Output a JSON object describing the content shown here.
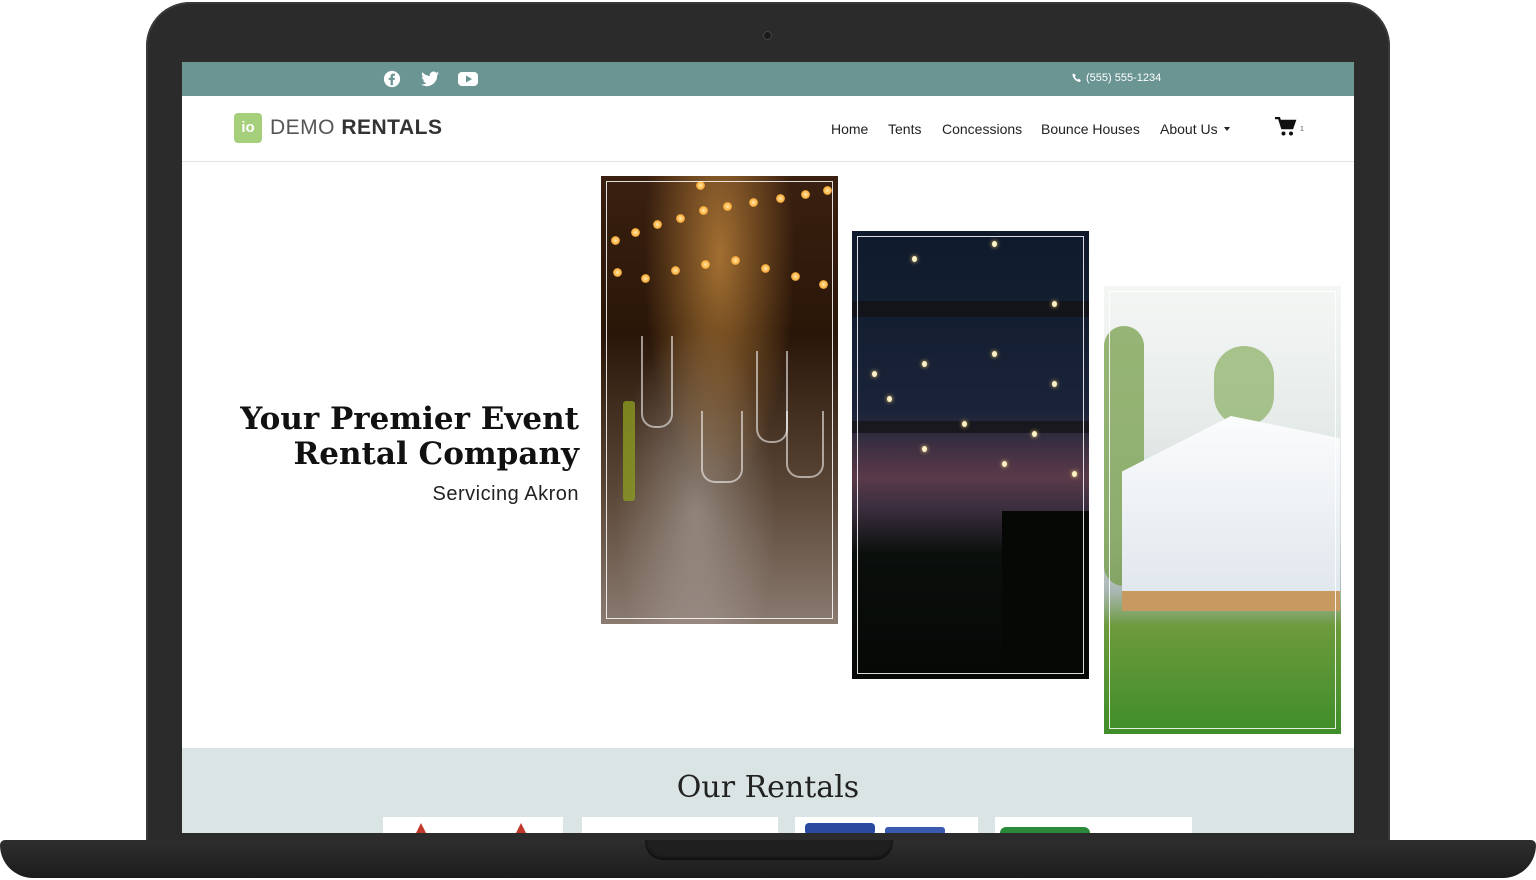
{
  "topbar": {
    "social_icons": [
      "facebook-icon",
      "twitter-icon",
      "youtube-icon"
    ],
    "phone": "(555) 555-1234",
    "bg_color": "#6a9593"
  },
  "nav": {
    "logo_mark": "io",
    "logo_word1": "DEMO",
    "logo_word2": "RENTALS",
    "items": [
      {
        "label": "Home"
      },
      {
        "label": "Tents"
      },
      {
        "label": "Concessions"
      },
      {
        "label": "Bounce Houses"
      },
      {
        "label": "About Us"
      }
    ],
    "cart_count": "1"
  },
  "hero": {
    "title_line1": "Your Premier Event",
    "title_line2": "Rental Company",
    "subtitle": "Servicing Akron"
  },
  "rentals": {
    "title": "Our Rentals",
    "bg_color": "#dbe4e4"
  }
}
